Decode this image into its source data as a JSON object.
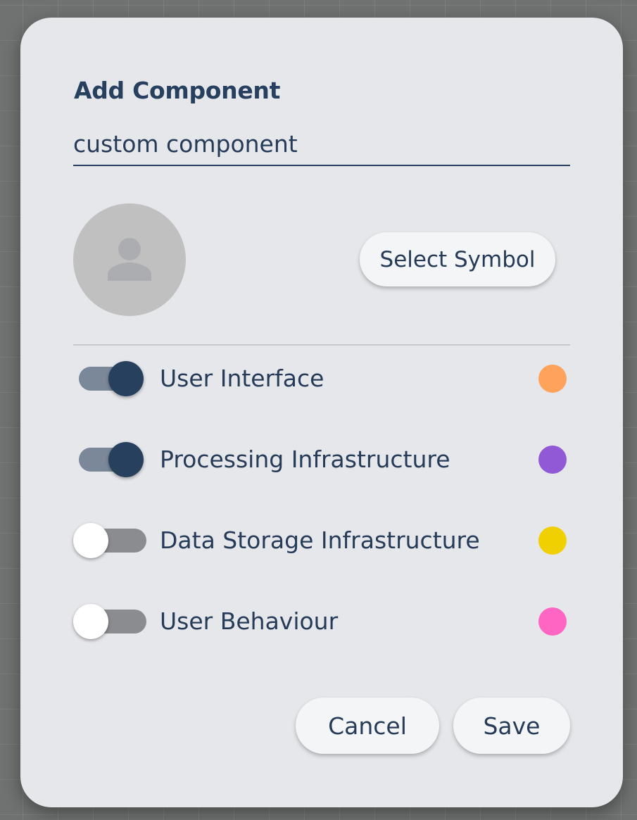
{
  "dialog": {
    "title": "Add Component",
    "name_value": "custom component",
    "avatar_icon": "person-icon",
    "select_symbol_label": "Select Symbol",
    "cancel_label": "Cancel",
    "save_label": "Save"
  },
  "layers": [
    {
      "label": "User Interface",
      "enabled": true,
      "color": "#ffa35c"
    },
    {
      "label": "Processing Infrastructure",
      "enabled": true,
      "color": "#9159d6"
    },
    {
      "label": "Data Storage Infrastructure",
      "enabled": false,
      "color": "#f0d000"
    },
    {
      "label": "User Behaviour",
      "enabled": false,
      "color": "#ff66c4"
    }
  ]
}
